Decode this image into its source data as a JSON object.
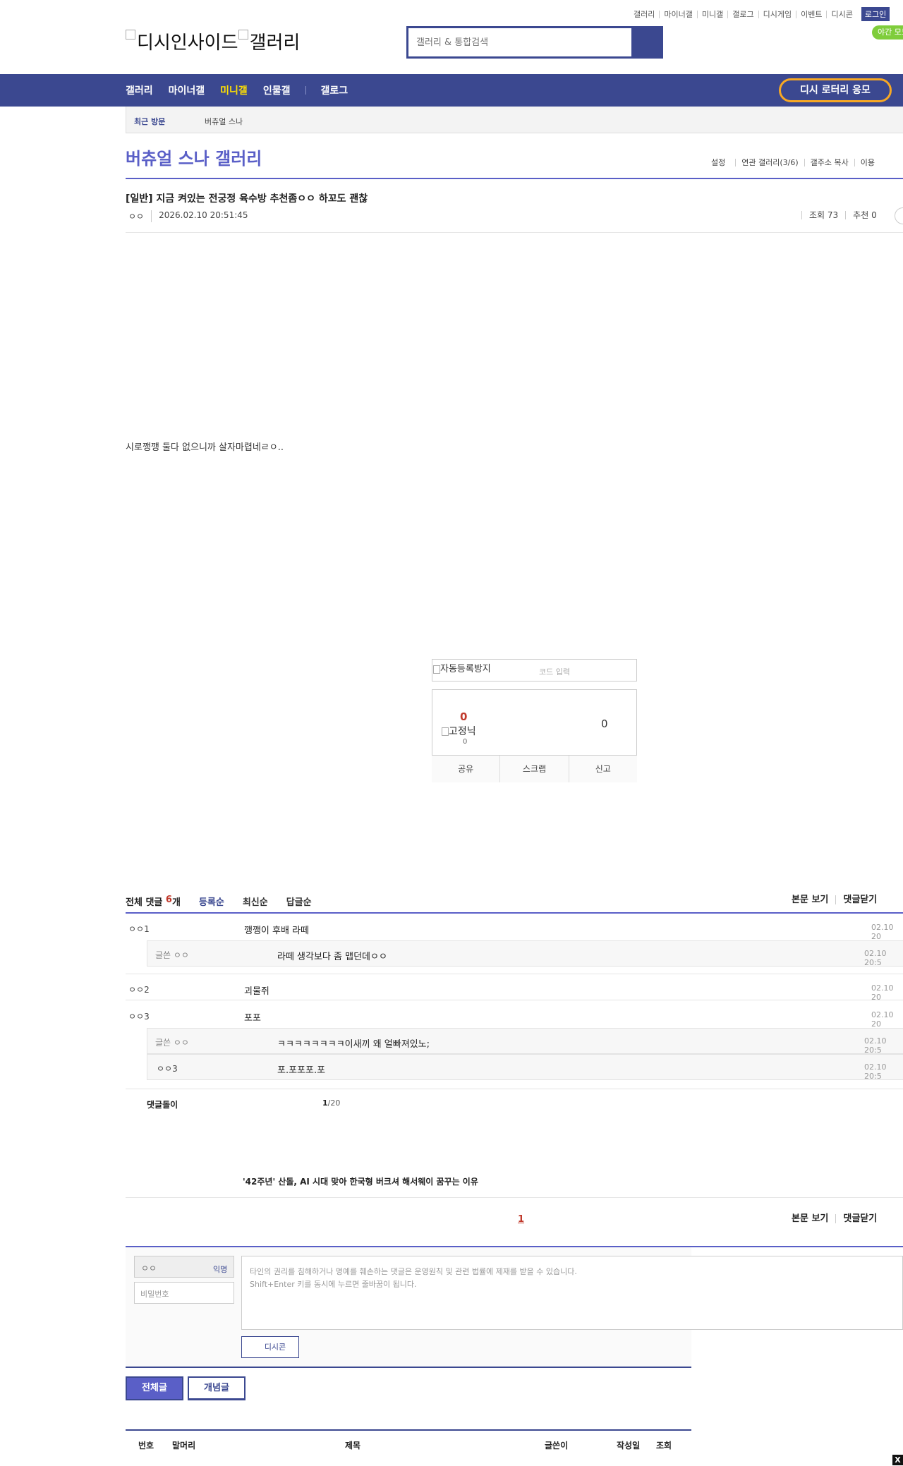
{
  "top_links": [
    "갤러리",
    "마이너갤",
    "미니갤",
    "갤로그",
    "디시게임",
    "이벤트",
    "디시콘"
  ],
  "login_label": "로그인",
  "night_mode_label": "야간 모드",
  "logo": {
    "site_alt": "디시인사이드",
    "gallery_alt": "갤러리"
  },
  "search": {
    "placeholder": "갤러리 & 통합검색"
  },
  "nav": {
    "items": [
      "갤러리",
      "마이너갤",
      "미니갤",
      "인물갤",
      "갤로그"
    ],
    "active_index": 2,
    "lotto_label": "디시 로터리 응모"
  },
  "recent": {
    "label": "최근 방문",
    "item": "버츄얼 스나"
  },
  "gallery": {
    "title": "버츄얼 스나 갤러리",
    "menu": [
      "설정",
      "연관 갤러리(3/6)",
      "갤주소 복사",
      "이용"
    ]
  },
  "post": {
    "title": "[일반] 지금 켜있는 전궁정 육수방 추천좀ㅇㅇ 하꼬도 괜찮",
    "author": "ㅇㅇ",
    "date": "2026.02.10 20:51:45",
    "views": "조회 73",
    "recommend": "추천 0",
    "body": "시로깽깽 둘다 없으니까 살자마렵네ㄹㅇ.."
  },
  "captcha": {
    "image_alt": "자동등록방지",
    "input_placeholder": "코드 입력"
  },
  "vote": {
    "up_count": "0",
    "fixed_nick_alt": "고정닉",
    "fixed_nick_count": "0",
    "down_count": "0",
    "actions": [
      "공유",
      "스크랩",
      "신고"
    ]
  },
  "comments": {
    "total_label": "전체 댓글",
    "count": "6",
    "count_unit": "개",
    "sorts": [
      "등록순",
      "최신순",
      "답글순"
    ],
    "links": [
      "본문 보기",
      "댓글닫기"
    ],
    "rows": [
      {
        "nick": "ㅇㅇ1",
        "text": "깽깽이 후배 라떼",
        "date": "02.10 20",
        "reply": false
      },
      {
        "nick": "글쓴 ㅇㅇ",
        "text": "라떼 생각보다 좀 맵던데ㅇㅇ",
        "date": "02.10 20:5",
        "reply": true
      },
      {
        "nick": "ㅇㅇ2",
        "text": "괴물쥐",
        "date": "02.10 20",
        "reply": false
      },
      {
        "nick": "ㅇㅇ3",
        "text": "포포",
        "date": "02.10 20",
        "reply": false
      },
      {
        "nick": "글쓴 ㅇㅇ",
        "text": "ㅋㅋㅋㅋㅋㅋㅋㅋ이새끼 왜 얼빠져있노;",
        "date": "02.10 20:5",
        "reply": true
      },
      {
        "nick": "ㅇㅇ3",
        "text": "포.포포포.포",
        "date": "02.10 20:5",
        "reply": true
      }
    ],
    "refresh_label": "댓글돌이",
    "page_current": "1",
    "page_total": "/20"
  },
  "news_link": "'42주년' 산돌, AI 시대 맞아 한국형 버크셔 해서웨이 꿈꾸는 이유",
  "pagination": {
    "current": "1",
    "links": [
      "본문 보기",
      "댓글닫기"
    ]
  },
  "write": {
    "nick_value": "ㅇㅇ",
    "anon_label": "익명",
    "password_placeholder": "비밀번호",
    "textarea_line1": "타인의 권리를 침해하거나 명예를 훼손하는 댓글은 운영원칙 및 관련 법률에 제재를 받을 수 있습니다.",
    "textarea_line2": "Shift+Enter 키를 동시에 누르면 줄바꿈이 됩니다.",
    "dccon_label": "디시콘"
  },
  "list_tabs": {
    "all": "전체글",
    "best": "개념글"
  },
  "list": {
    "headers": [
      "번호",
      "말머리",
      "제목",
      "글쓴이",
      "작성일",
      "조회"
    ]
  },
  "close_label": "X",
  "colors": {
    "brand": "#3b4890",
    "accent": "#5a5fc7",
    "highlight": "#ffe100",
    "lotto_border": "#f7a824",
    "alert": "#c0392b"
  }
}
